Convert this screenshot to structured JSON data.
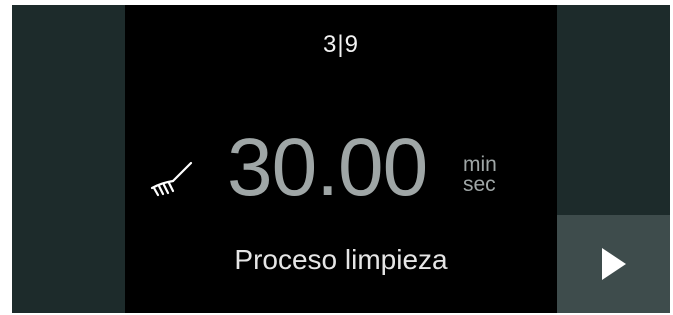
{
  "header": {
    "step_current": "3",
    "step_total": "9"
  },
  "timer": {
    "value": "30.00",
    "unit_top": "min",
    "unit_bottom": "sec"
  },
  "program": {
    "name": "Proceso limpieza",
    "icon": "brush-icon"
  },
  "navigation": {
    "next_icon": "play-arrow-icon"
  },
  "colors": {
    "side_panel": "#1d2b2b",
    "next_button": "#3e4c4c",
    "timer_text": "#9fa6a6",
    "background": "#000000"
  }
}
